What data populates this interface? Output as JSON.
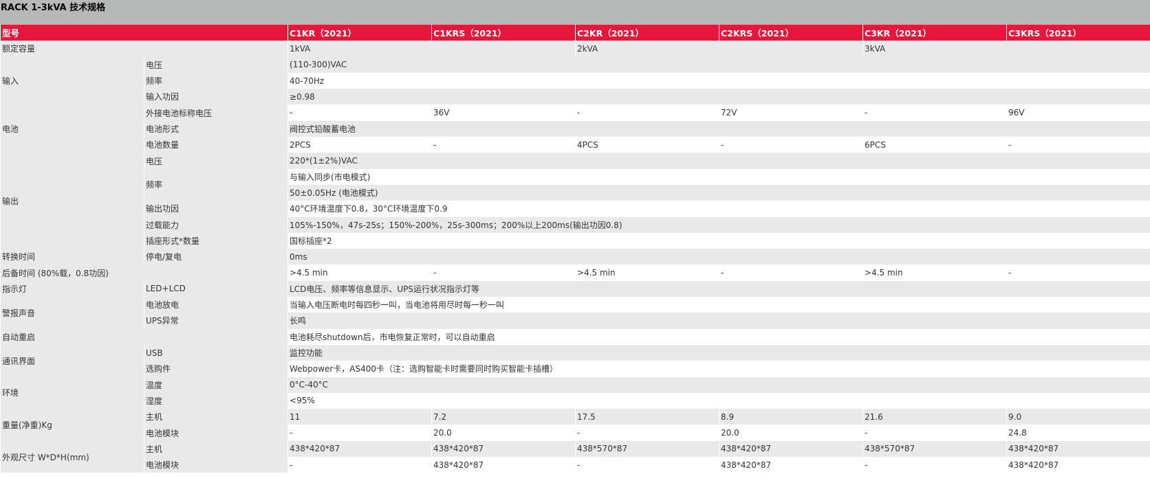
{
  "title": "RACK 1-3kVA 技术规格",
  "columns": [
    "型号",
    "C1KR（2021）",
    "C1KRS（2021）",
    "C2KR（2021）",
    "C2KRS（2021）",
    "C3KR（2021）",
    "C3KRS（2021）"
  ],
  "labels": {
    "rated_capacity": "额定容量",
    "input": "输入",
    "battery": "电池",
    "output": "输出",
    "transfer_time": "转换时间",
    "backup_time": "后备时间 (80%载，0.8功因)",
    "indicator": "指示灯",
    "alarm": "警报声音",
    "auto_restart": "自动重启",
    "comm": "通讯界面",
    "env": "环境",
    "weight": "重量(净重)Kg",
    "dimension": "外观尺寸 W*D*H(mm)"
  },
  "sub": {
    "input_voltage": "电压",
    "input_freq": "频率",
    "input_pf": "输入功因",
    "bat_voltage": "外接电池标称电压",
    "bat_type": "电池形式",
    "bat_count": "电池数量",
    "out_voltage": "电压",
    "out_freq": "频率",
    "out_pf": "输出功因",
    "overload": "过载能力",
    "socket": "插座形式*数量",
    "transfer": "停电/复电",
    "indicator": "LED+LCD",
    "alarm_discharge": "电池放电",
    "alarm_ups": "UPS异常",
    "usb": "USB",
    "option": "选购件",
    "temp": "温度",
    "humidity": "湿度",
    "weight_main": "主机",
    "weight_bat": "电池模块",
    "dim_main": "主机",
    "dim_bat": "电池模块"
  },
  "values": {
    "rated_capacity": [
      "1kVA",
      "2kVA",
      "3kVA"
    ],
    "input_voltage": "(110-300)VAC",
    "input_freq": "40-70Hz",
    "input_pf": "≥0.98",
    "bat_voltage": [
      "-",
      "36V",
      "-",
      "72V",
      "-",
      "96V"
    ],
    "bat_type": "阀控式铅酸蓄电池",
    "bat_count": [
      "2PCS",
      "-",
      "4PCS",
      "-",
      "6PCS",
      "-"
    ],
    "out_voltage": "220*(1±2%)VAC",
    "out_freq_1": "与输入同步(市电模式)",
    "out_freq_2": "50±0.05Hz (电池模式)",
    "out_pf": "40°C环境温度下0.8，30°C环境温度下0.9",
    "overload": "105%-150%，47s-25s；150%-200%，25s-300ms；200%以上200ms(输出功因0.8)",
    "socket": "国标插座*2",
    "transfer": "0ms",
    "backup_time": [
      ">4.5 min",
      "-",
      ">4.5 min",
      "-",
      ">4.5 min",
      "-"
    ],
    "indicator": "LCD电压、频率等信息显示、UPS运行状况指示灯等",
    "alarm_discharge": "当输入电压断电时每四秒一叫，当电池将用尽时每一秒一叫",
    "alarm_ups": "长鸣",
    "auto_restart": "电池耗尽shutdown后，市电恢复正常时，可以自动重启",
    "usb": "监控功能",
    "option": "Webpower卡，AS400卡（注：选购智能卡时需要同时购买智能卡插槽）",
    "temp": "0°C-40°C",
    "humidity": "<95%",
    "weight_main": [
      "11",
      "7.2",
      "17.5",
      "8.9",
      "21.6",
      "9.0"
    ],
    "weight_bat": [
      "-",
      "20.0",
      "-",
      "20.0",
      "-",
      "24.8"
    ],
    "dim_main": [
      "438*420*87",
      "438*420*87",
      "438*570*87",
      "438*420*87",
      "438*570*87",
      "438*420*87"
    ],
    "dim_bat": [
      "-",
      "438*420*87",
      "-",
      "438*420*87",
      "-",
      "438*420*87"
    ]
  }
}
